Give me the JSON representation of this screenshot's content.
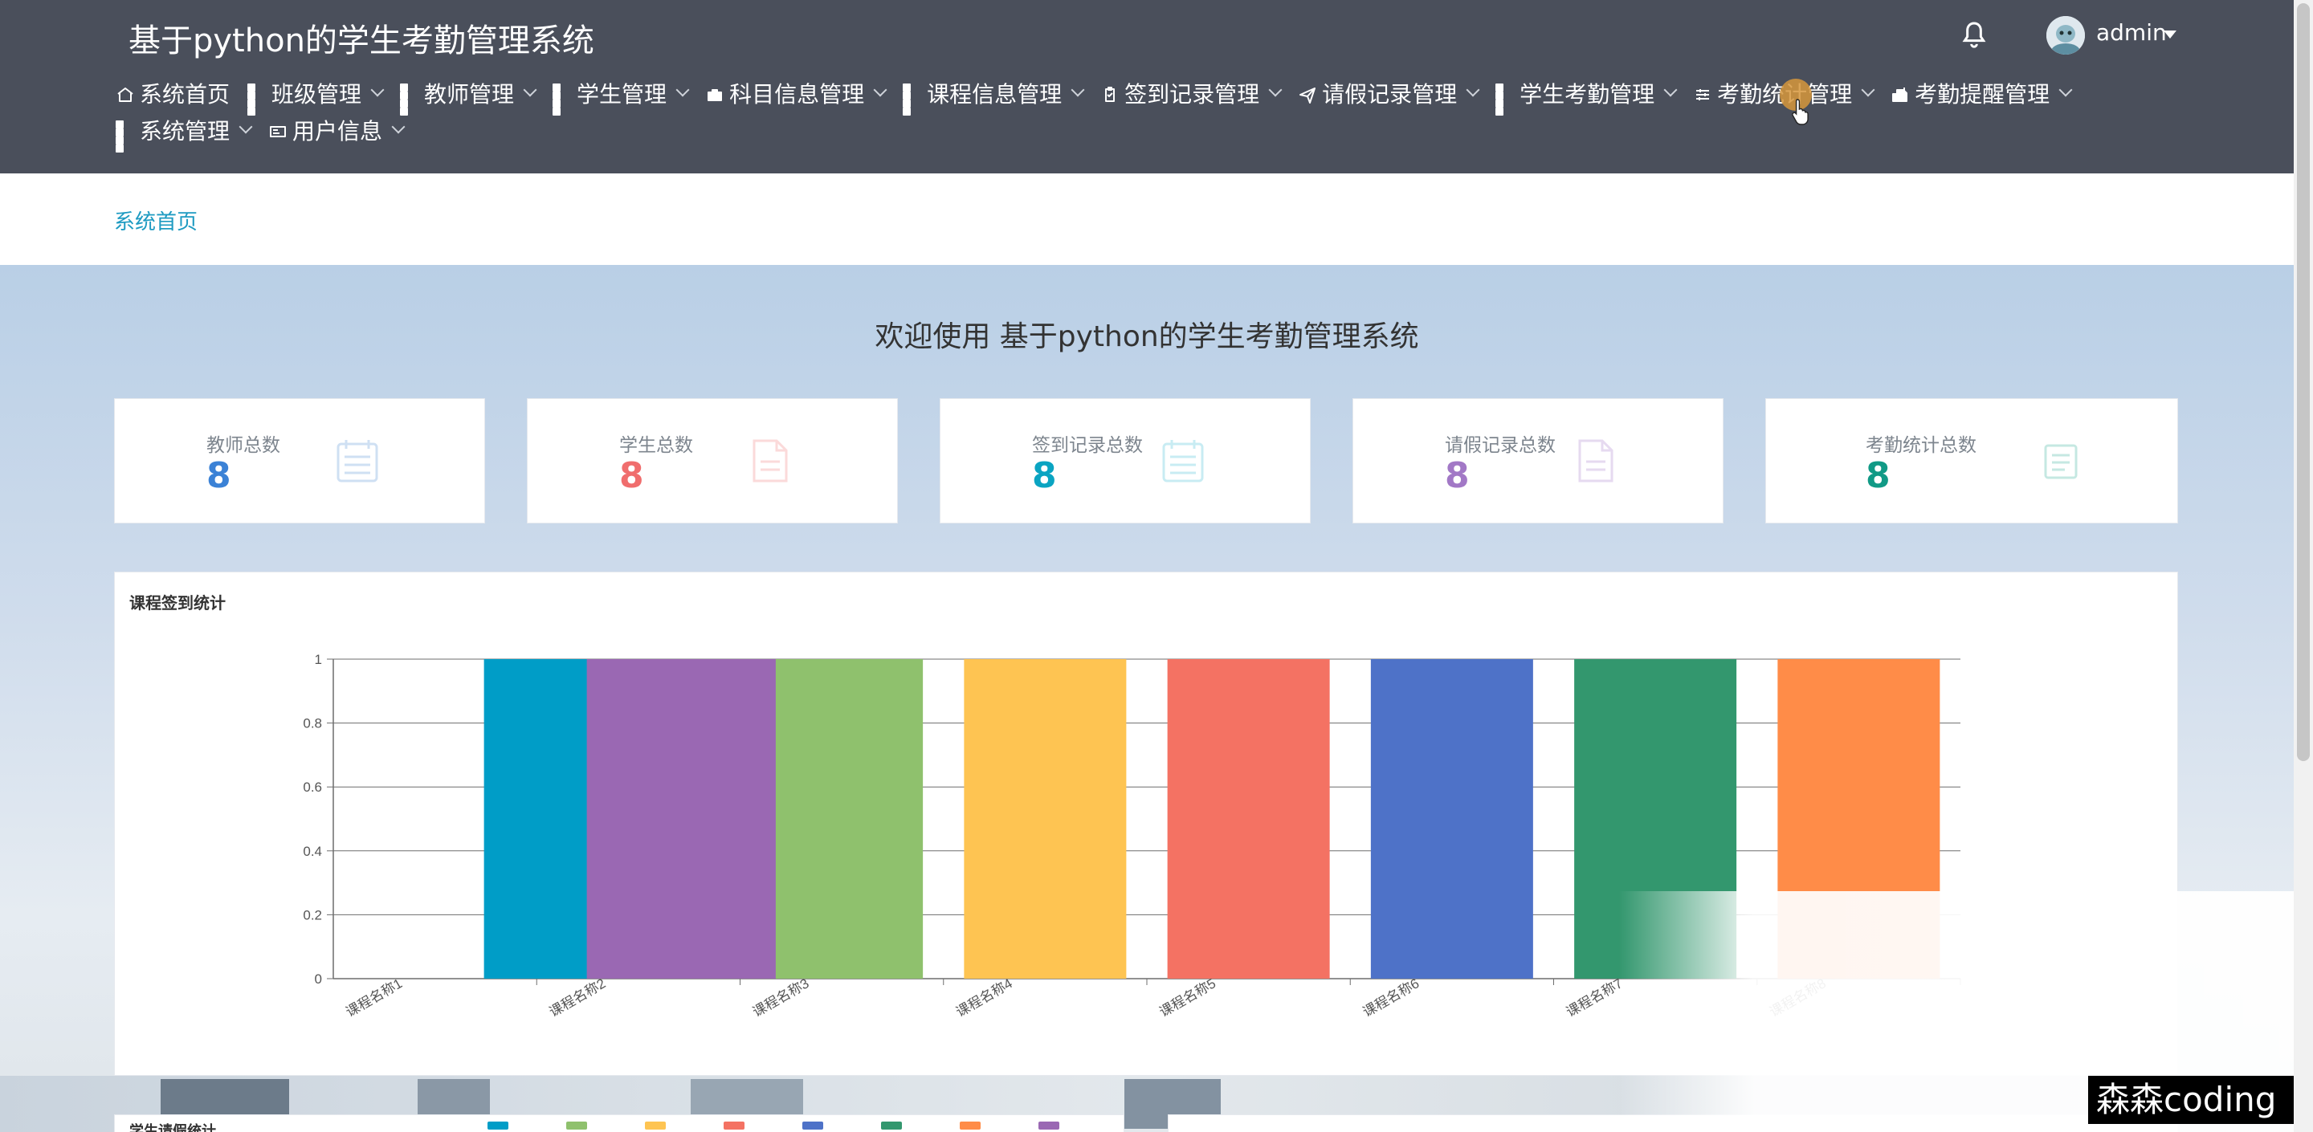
{
  "header": {
    "title": "基于python的学生考勤管理系统",
    "user": "admin",
    "nav": [
      {
        "label": "系统首页",
        "icon": "home-icon",
        "dropdown": false
      },
      {
        "label": "班级管理",
        "icon": "grid-icon",
        "dropdown": true
      },
      {
        "label": "教师管理",
        "icon": "grid-icon",
        "dropdown": true
      },
      {
        "label": "学生管理",
        "icon": "grid-icon",
        "dropdown": true
      },
      {
        "label": "科目信息管理",
        "icon": "briefcase-icon",
        "dropdown": true
      },
      {
        "label": "课程信息管理",
        "icon": "grid-icon",
        "dropdown": true
      },
      {
        "label": "签到记录管理",
        "icon": "clipboard-icon",
        "dropdown": true
      },
      {
        "label": "请假记录管理",
        "icon": "send-icon",
        "dropdown": true
      },
      {
        "label": "学生考勤管理",
        "icon": "grid-icon",
        "dropdown": true
      },
      {
        "label": "考勤统计管理",
        "icon": "sliders-icon",
        "dropdown": true
      },
      {
        "label": "考勤提醒管理",
        "icon": "mailbox-icon",
        "dropdown": true
      },
      {
        "label": "系统管理",
        "icon": "grid-icon",
        "dropdown": true
      },
      {
        "label": "用户信息",
        "icon": "id-card-icon",
        "dropdown": true
      }
    ]
  },
  "breadcrumb": "系统首页",
  "welcome": "欢迎使用 基于python的学生考勤管理系统",
  "stats": [
    {
      "label": "教师总数",
      "value": "8",
      "color": "#3b82d6",
      "icon_color": "#cfe0f3"
    },
    {
      "label": "学生总数",
      "value": "8",
      "color": "#f06d6d",
      "icon_color": "#fbdada"
    },
    {
      "label": "签到记录总数",
      "value": "8",
      "color": "#0aa4c2",
      "icon_color": "#c8ecf3"
    },
    {
      "label": "请假记录总数",
      "value": "8",
      "color": "#a278c6",
      "icon_color": "#e6daf0"
    },
    {
      "label": "考勤统计总数",
      "value": "8",
      "color": "#119a86",
      "icon_color": "#c5e8e2"
    }
  ],
  "chart_data": {
    "type": "bar",
    "title": "课程签到统计",
    "categories": [
      "课程名称1",
      "课程名称2",
      "课程名称3",
      "课程名称4",
      "课程名称5",
      "课程名称6",
      "课程名称7",
      "课程名称8"
    ],
    "values": [
      0,
      1,
      1,
      1,
      1,
      1,
      1,
      1
    ],
    "extra_bar_values": [
      1
    ],
    "colors": [
      "#009dc7",
      "#9a68b3",
      "#8fc16d",
      "#fec452",
      "#f47263",
      "#4e72c8",
      "#33976e",
      "#ff8c48"
    ],
    "ylim": [
      0,
      1
    ],
    "yticks": [
      "0",
      "0.2",
      "0.4",
      "0.6",
      "0.8",
      "1"
    ],
    "grid": true
  },
  "bottom": {
    "left_title": "学生请假统计",
    "legend": [
      "#009dc7",
      "#8fc16d",
      "#fec452",
      "#f47263",
      "#4e72c8",
      "#33976e",
      "#ff8c48",
      "#9a68b3"
    ]
  },
  "watermark": "森森coding"
}
